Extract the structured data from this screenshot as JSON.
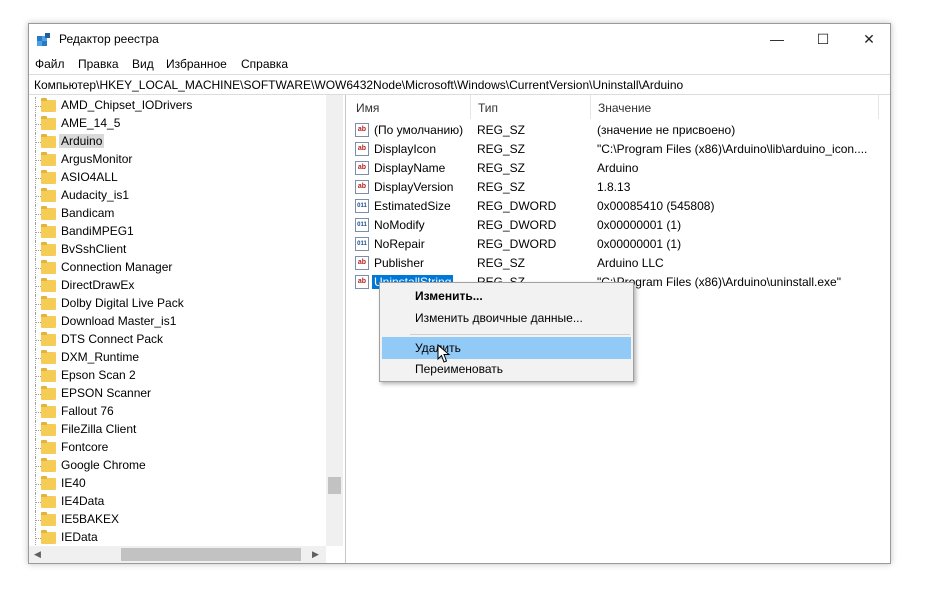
{
  "window": {
    "title": "Редактор реестра",
    "controls": {
      "minimize": "—",
      "maximize": "☐",
      "close": "✕"
    }
  },
  "menu": [
    "Файл",
    "Правка",
    "Вид",
    "Избранное",
    "Справка"
  ],
  "address": "Компьютер\\HKEY_LOCAL_MACHINE\\SOFTWARE\\WOW6432Node\\Microsoft\\Windows\\CurrentVersion\\Uninstall\\Arduino",
  "tree": {
    "items": [
      "AMD_Chipset_IODrivers",
      "AME_14_5",
      "Arduino",
      "ArgusMonitor",
      "ASIO4ALL",
      "Audacity_is1",
      "Bandicam",
      "BandiMPEG1",
      "BvSshClient",
      "Connection Manager",
      "DirectDrawEx",
      "Dolby Digital Live Pack",
      "Download Master_is1",
      "DTS Connect Pack",
      "DXM_Runtime",
      "Epson Scan 2",
      "EPSON Scanner",
      "Fallout 76",
      "FileZilla Client",
      "Fontcore",
      "Google Chrome",
      "IE40",
      "IE4Data",
      "IE5BAKEX",
      "IEData"
    ],
    "selected_index": 2
  },
  "columns": {
    "name": "Имя",
    "type": "Тип",
    "data": "Значение"
  },
  "values": [
    {
      "icon": "string-value-icon",
      "icon_text": "ab",
      "name": "(По умолчанию)",
      "type": "REG_SZ",
      "data": "(значение не присвоено)"
    },
    {
      "icon": "string-value-icon",
      "icon_text": "ab",
      "name": "DisplayIcon",
      "type": "REG_SZ",
      "data": "\"C:\\Program Files (x86)\\Arduino\\lib\\arduino_icon...."
    },
    {
      "icon": "string-value-icon",
      "icon_text": "ab",
      "name": "DisplayName",
      "type": "REG_SZ",
      "data": "Arduino"
    },
    {
      "icon": "string-value-icon",
      "icon_text": "ab",
      "name": "DisplayVersion",
      "type": "REG_SZ",
      "data": "1.8.13"
    },
    {
      "icon": "dword-value-icon",
      "icon_text": "011",
      "name": "EstimatedSize",
      "type": "REG_DWORD",
      "data": "0x00085410 (545808)"
    },
    {
      "icon": "dword-value-icon",
      "icon_text": "011",
      "name": "NoModify",
      "type": "REG_DWORD",
      "data": "0x00000001 (1)"
    },
    {
      "icon": "dword-value-icon",
      "icon_text": "011",
      "name": "NoRepair",
      "type": "REG_DWORD",
      "data": "0x00000001 (1)"
    },
    {
      "icon": "string-value-icon",
      "icon_text": "ab",
      "name": "Publisher",
      "type": "REG_SZ",
      "data": "Arduino LLC"
    },
    {
      "icon": "string-value-icon",
      "icon_text": "ab",
      "name": "UninstallString",
      "type": "REG_SZ",
      "data": "\"C:\\Program Files (x86)\\Arduino\\uninstall.exe\""
    }
  ],
  "selected_value_index": 8,
  "context_menu": {
    "items": [
      "Изменить...",
      "Изменить двоичные данные...",
      "Удалить",
      "Переименовать"
    ],
    "hover_index": 2
  },
  "colors": {
    "selection": "#0078d7",
    "menu_hover": "#91c9f7",
    "folder": "#f5cc55"
  }
}
